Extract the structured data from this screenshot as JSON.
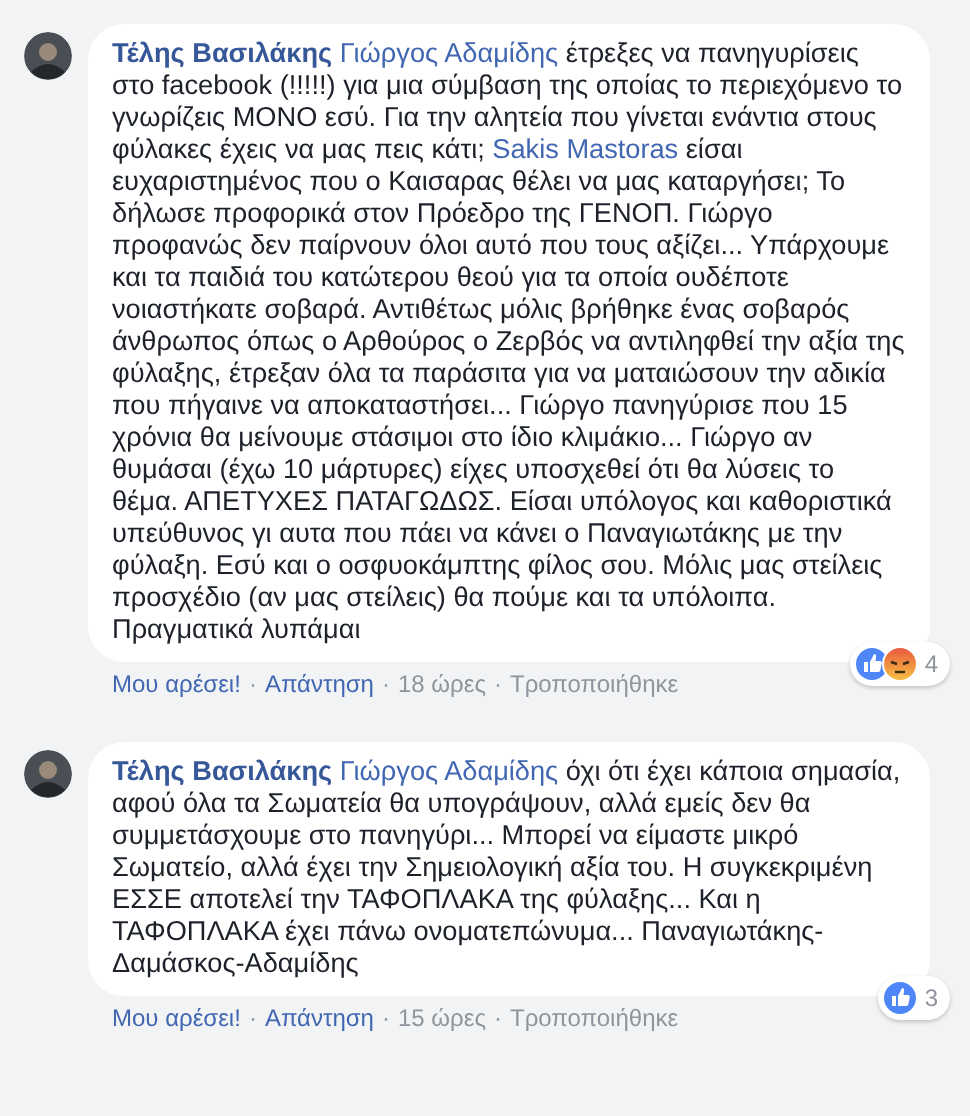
{
  "comments": [
    {
      "author": "Τέλης Βασιλάκης",
      "segments": [
        {
          "kind": "mention",
          "text": "Γιώργος Αδαμίδης"
        },
        {
          "kind": "text",
          "text": "έτρεξες να πανηγυρίσεις στο facebook (!!!!!) για μια σύμβαση της οποίας το περιεχόμενο το γνωρίζεις ΜΟΝΟ εσύ. Για την αλητεία που γίνεται ενάντια στους φύλακες έχεις να μας πεις κάτι;"
        },
        {
          "kind": "mention",
          "text": "Sakis Mastoras"
        },
        {
          "kind": "text",
          "text": "είσαι ευχαριστημένος που ο Καισαρας θέλει να μας καταργήσει; Το δήλωσε προφορικά στον Πρόεδρο της ΓΕΝΟΠ. Γιώργο προφανώς δεν παίρνουν όλοι αυτό που τους αξίζει... Υπάρχουμε και τα παιδιά του κατώτερου θεού για τα οποία ουδέποτε νοιαστήκατε σοβαρά. Αντιθέτως μόλις βρήθηκε ένας σοβαρός άνθρωπος όπως ο Αρθούρος ο Ζερβός να αντιληφθεί την αξία της φύλαξης, έτρεξαν όλα τα παράσιτα για να ματαιώσουν την αδικία που πήγαινε να αποκαταστήσει... Γιώργο πανηγύρισε που 15 χρόνια θα μείνουμε στάσιμοι στο ίδιο κλιμάκιο... Γιώργο αν θυμάσαι (έχω 10 μάρτυρες) είχες υποσχεθεί ότι θα λύσεις το θέμα. ΑΠΕΤΥΧΕΣ ΠΑΤΑΓΩΔΩΣ. Είσαι υπόλογος και καθοριστικά υπεύθυνος γι αυτα που πάει να κάνει ο Παναγιωτάκης με την φύλαξη. Εσύ και ο οσφυοκάμπτης φίλος σου. Μόλις μας στείλεις προσχέδιο (αν μας στείλεις) θα πούμε και τα υπόλοιπα. Πραγματικά λυπάμαι"
        }
      ],
      "reactions": [
        {
          "kind": "like"
        },
        {
          "kind": "angry"
        }
      ],
      "reaction_count": "4",
      "actions": [
        {
          "kind": "link",
          "text": "Μου αρέσει!"
        },
        {
          "kind": "sep",
          "text": "·"
        },
        {
          "kind": "link",
          "text": "Απάντηση"
        },
        {
          "kind": "sep",
          "text": "·"
        },
        {
          "kind": "time",
          "text": "18 ώρες"
        },
        {
          "kind": "sep",
          "text": "·"
        },
        {
          "kind": "edited",
          "text": "Τροποποιήθηκε"
        }
      ]
    },
    {
      "author": "Τέλης Βασιλάκης",
      "segments": [
        {
          "kind": "mention",
          "text": "Γιώργος Αδαμίδης"
        },
        {
          "kind": "text",
          "text": "όχι ότι έχει κάποια σημασία, αφού όλα τα Σωματεία θα υπογράψουν, αλλά εμείς δεν θα συμμετάσχουμε στο πανηγύρι... Μπορεί να είμαστε μικρό Σωματείο, αλλά έχει την Σημειολογική αξία του. Η συγκεκριμένη ΕΣΣΕ αποτελεί την ΤΑΦΟΠΛΑΚΑ της φύλαξης... Και η ΤΑΦΟΠΛΑΚΑ έχει πάνω ονοματεπώνυμα... Παναγιωτάκης-Δαμάσκος-Αδαμίδης"
        }
      ],
      "reactions": [
        {
          "kind": "like"
        }
      ],
      "reaction_count": "3",
      "actions": [
        {
          "kind": "link",
          "text": "Μου αρέσει!"
        },
        {
          "kind": "sep",
          "text": "·"
        },
        {
          "kind": "link",
          "text": "Απάντηση"
        },
        {
          "kind": "sep",
          "text": "·"
        },
        {
          "kind": "time",
          "text": "15 ώρες"
        },
        {
          "kind": "sep",
          "text": "·"
        },
        {
          "kind": "edited",
          "text": "Τροποποιήθηκε"
        }
      ]
    }
  ]
}
